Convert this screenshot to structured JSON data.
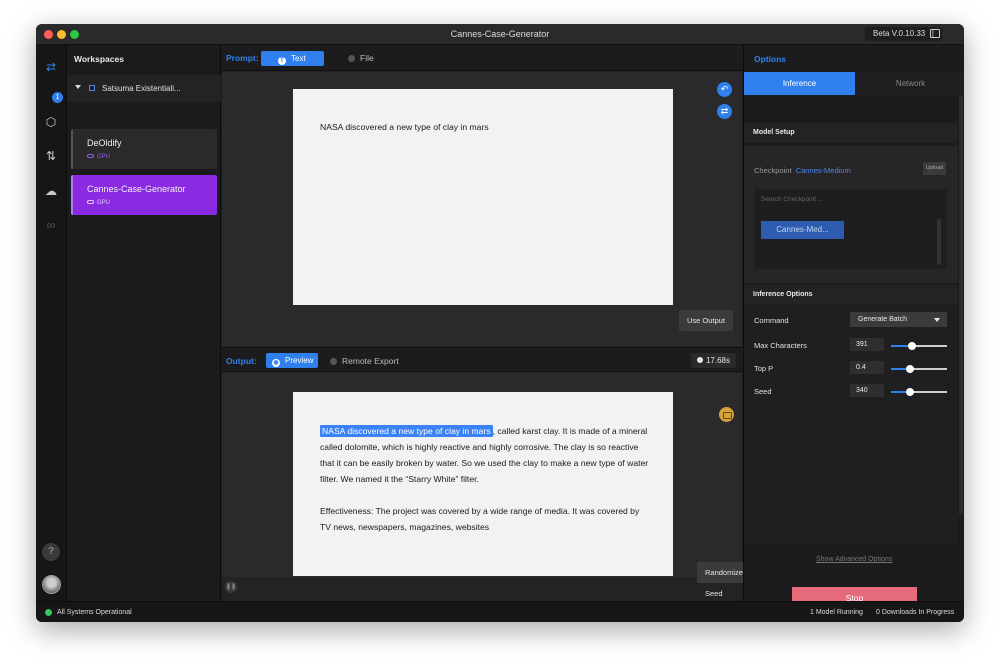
{
  "window": {
    "title": "Cannes-Case-Generator",
    "version": "Beta V.0.10.33",
    "separator": "|"
  },
  "rail": {
    "badge": "1",
    "help": "?"
  },
  "workspaces": {
    "title": "Workspaces",
    "group": "Satsuma Existentiali...",
    "items": [
      {
        "name": "DeOldify",
        "tag": "GPU",
        "active": false
      },
      {
        "name": "Cannes-Case-Generator",
        "tag": "GPU",
        "active": true
      }
    ]
  },
  "prompt": {
    "label": "Prompt:",
    "tab_text": "Text",
    "tab_text_icon": "T",
    "tab_file": "File",
    "text": "NASA discovered a new type of clay in mars",
    "use_output": "Use Output"
  },
  "output": {
    "label": "Output:",
    "tab_preview": "Preview",
    "tab_export": "Remote Export",
    "time": "17.68s",
    "highlight": "NASA discovered a new type of clay in mars",
    "rest": ", called karst clay. It is made of a mineral called dolomite, which is highly reactive and highly corrosive. The clay is so reactive that it can be easily broken by water. So we used the clay to make a new type of water filter. We named it the “Starry White” filter.",
    "para2": "Effectiveness: The project was covered by a wide range of media. It was covered by TV news, newspapers, magazines, websites",
    "randomize": "Randomize Seed"
  },
  "options": {
    "title": "Options",
    "tab_inference": "Inference",
    "tab_network": "Network",
    "model_setup": "Model Setup",
    "checkpoint_label": "Checkpoint",
    "checkpoint_value": "Cannes-Medium",
    "upload": "Upload",
    "search_placeholder": "Search Checkpoint ...",
    "checkpoint_chip": "Cannes-Med...",
    "inference_options": "Inference Options",
    "command_label": "Command",
    "command_value": "Generate Batch",
    "max_chars_label": "Max Characters",
    "max_chars_value": "391",
    "top_p_label": "Top P",
    "top_p_value": "0.4",
    "seed_label": "Seed",
    "seed_value": "340",
    "slider_levels": {
      "max_chars": 0.38,
      "top_p": 0.34,
      "seed": 0.34
    },
    "advanced": "Show Advanced Options",
    "stop": "Stop"
  },
  "status": {
    "left": "All Systems Operational",
    "models": "1 Model Running",
    "downloads": "0 Downloads In Progress"
  },
  "colors": {
    "accent": "#2f80ed",
    "active_workspace": "#8a2be2",
    "stop": "#e56b7a",
    "ok": "#34c759"
  }
}
